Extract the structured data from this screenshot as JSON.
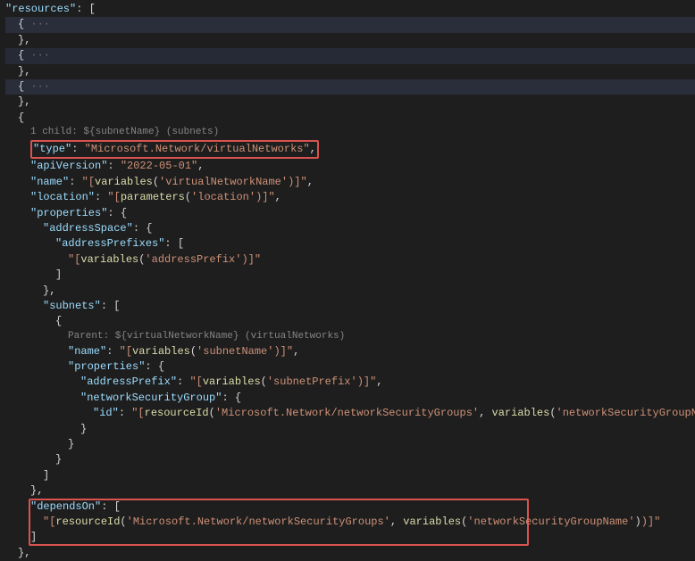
{
  "resourcesKey": "\"resources\"",
  "arrOpen": ": [",
  "collapsed": "{ ···",
  "closeBrC": "},",
  "openBr": "{",
  "hint1": "1 child: ${subnetName} (subnets)",
  "typeKey": "\"type\"",
  "typeVal": "\"Microsoft.Network/virtualNetworks\"",
  "apiKey": "\"apiVersion\"",
  "apiVal": "\"2022-05-01\"",
  "nameKey": "\"name\"",
  "nameVal1": "\"[",
  "varFn": "variables",
  "nameArg": "'virtualNetworkName'",
  "closeExpr": ")]\"",
  "locKey": "\"location\"",
  "paramFn": "parameters",
  "locArg": "'location'",
  "propsKey": "\"properties\"",
  "addrSpaceKey": "\"addressSpace\"",
  "addrPrefKey": "\"addressPrefixes\"",
  "addrPrefArg": "'addressPrefix'",
  "closeArr": "]",
  "subnetsKey": "\"subnets\"",
  "hint2": "Parent: ${virtualNetworkName} (virtualNetworks)",
  "subnetNameArg": "'subnetName'",
  "addrPrefixKey": "\"addressPrefix\"",
  "subnetPrefArg": "'subnetPrefix'",
  "nsgKey": "\"networkSecurityGroup\"",
  "idKey": "\"id\"",
  "resIdFn": "resourceId",
  "nsgType": "'Microsoft.Network/networkSecurityGroups'",
  "nsgNameArg": "'networkSecurityGroupName'",
  "closeBr": "}",
  "dependsKey": "\"dependsOn\"",
  "comma": ",",
  "colonBr": ": {",
  "colonArr": ": ["
}
